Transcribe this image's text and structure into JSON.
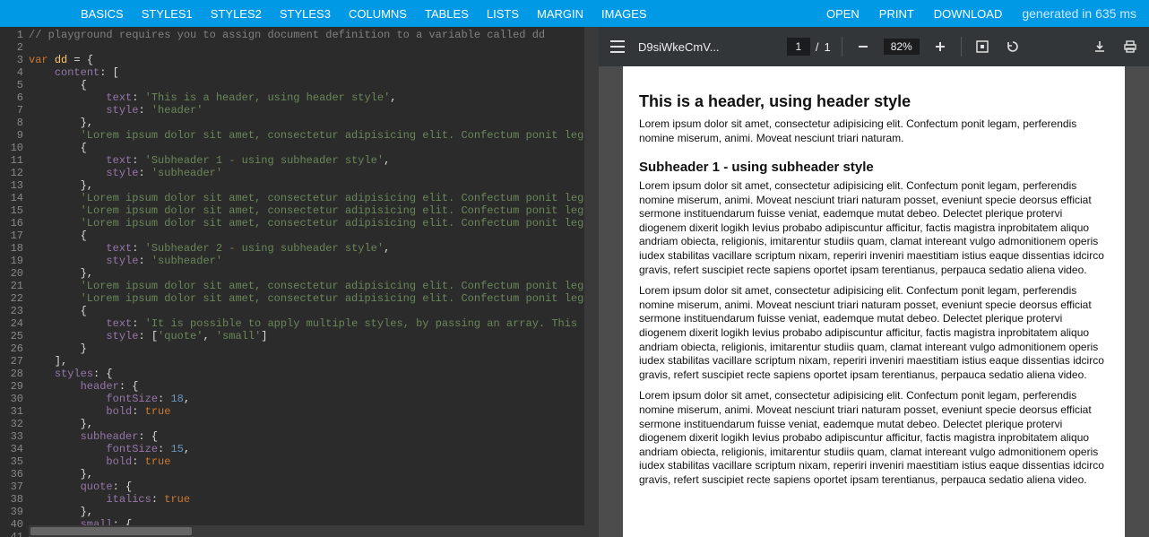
{
  "topbar": {
    "nav_left": [
      "BASICS",
      "STYLES1",
      "STYLES2",
      "STYLES3",
      "COLUMNS",
      "TABLES",
      "LISTS",
      "MARGIN",
      "IMAGES"
    ],
    "nav_right": [
      "OPEN",
      "PRINT",
      "DOWNLOAD"
    ],
    "generated": "generated in 635 ms"
  },
  "editor": {
    "lines": [
      {
        "n": 1,
        "tokens": [
          [
            "cmt",
            "// playground requires you to assign document definition to a variable called dd"
          ]
        ]
      },
      {
        "n": 2,
        "tokens": []
      },
      {
        "n": 3,
        "fold": true,
        "tokens": [
          [
            "kw",
            "var "
          ],
          [
            "id",
            "dd"
          ],
          [
            "pln",
            " = {"
          ]
        ]
      },
      {
        "n": 4,
        "fold": true,
        "tokens": [
          [
            "pln",
            "    "
          ],
          [
            "prop",
            "content"
          ],
          [
            "pln",
            ": ["
          ]
        ]
      },
      {
        "n": 5,
        "tokens": [
          [
            "pln",
            "        {"
          ]
        ]
      },
      {
        "n": 6,
        "tokens": [
          [
            "pln",
            "            "
          ],
          [
            "prop",
            "text"
          ],
          [
            "pln",
            ": "
          ],
          [
            "str",
            "'This is a header, using header style'"
          ],
          [
            "pln",
            ","
          ]
        ]
      },
      {
        "n": 7,
        "tokens": [
          [
            "pln",
            "            "
          ],
          [
            "prop",
            "style"
          ],
          [
            "pln",
            ": "
          ],
          [
            "str",
            "'header'"
          ]
        ]
      },
      {
        "n": 8,
        "tokens": [
          [
            "pln",
            "        },"
          ]
        ]
      },
      {
        "n": 9,
        "tokens": [
          [
            "pln",
            "        "
          ],
          [
            "str",
            "'Lorem ipsum dolor sit amet, consectetur adipisicing elit. Confectum ponit legam, per"
          ]
        ]
      },
      {
        "n": 10,
        "tokens": [
          [
            "pln",
            "        {"
          ]
        ]
      },
      {
        "n": 11,
        "tokens": [
          [
            "pln",
            "            "
          ],
          [
            "prop",
            "text"
          ],
          [
            "pln",
            ": "
          ],
          [
            "str",
            "'Subheader 1 - using subheader style'"
          ],
          [
            "pln",
            ","
          ]
        ]
      },
      {
        "n": 12,
        "tokens": [
          [
            "pln",
            "            "
          ],
          [
            "prop",
            "style"
          ],
          [
            "pln",
            ": "
          ],
          [
            "str",
            "'subheader'"
          ]
        ]
      },
      {
        "n": 13,
        "tokens": [
          [
            "pln",
            "        },"
          ]
        ]
      },
      {
        "n": 14,
        "tokens": [
          [
            "pln",
            "        "
          ],
          [
            "str",
            "'Lorem ipsum dolor sit amet, consectetur adipisicing elit. Confectum ponit legam, per"
          ]
        ]
      },
      {
        "n": 15,
        "tokens": [
          [
            "pln",
            "        "
          ],
          [
            "str",
            "'Lorem ipsum dolor sit amet, consectetur adipisicing elit. Confectum ponit legam, per"
          ]
        ]
      },
      {
        "n": 16,
        "tokens": [
          [
            "pln",
            "        "
          ],
          [
            "str",
            "'Lorem ipsum dolor sit amet, consectetur adipisicing elit. Confectum ponit legam, per"
          ]
        ]
      },
      {
        "n": 17,
        "tokens": [
          [
            "pln",
            "        {"
          ]
        ]
      },
      {
        "n": 18,
        "tokens": [
          [
            "pln",
            "            "
          ],
          [
            "prop",
            "text"
          ],
          [
            "pln",
            ": "
          ],
          [
            "str",
            "'Subheader 2 - using subheader style'"
          ],
          [
            "pln",
            ","
          ]
        ]
      },
      {
        "n": 19,
        "tokens": [
          [
            "pln",
            "            "
          ],
          [
            "prop",
            "style"
          ],
          [
            "pln",
            ": "
          ],
          [
            "str",
            "'subheader'"
          ]
        ]
      },
      {
        "n": 20,
        "tokens": [
          [
            "pln",
            "        },"
          ]
        ]
      },
      {
        "n": 21,
        "tokens": [
          [
            "pln",
            "        "
          ],
          [
            "str",
            "'Lorem ipsum dolor sit amet, consectetur adipisicing elit. Confectum ponit legam, per"
          ]
        ]
      },
      {
        "n": 22,
        "tokens": [
          [
            "pln",
            "        "
          ],
          [
            "str",
            "'Lorem ipsum dolor sit amet, consectetur adipisicing elit. Confectum ponit legam, per"
          ]
        ]
      },
      {
        "n": 23,
        "tokens": [
          [
            "pln",
            "        {"
          ]
        ]
      },
      {
        "n": 24,
        "tokens": [
          [
            "pln",
            "            "
          ],
          [
            "prop",
            "text"
          ],
          [
            "pln",
            ": "
          ],
          [
            "str",
            "'It is possible to apply multiple styles, by passing an array. This paragra"
          ]
        ]
      },
      {
        "n": 25,
        "tokens": [
          [
            "pln",
            "            "
          ],
          [
            "prop",
            "style"
          ],
          [
            "pln",
            ": ["
          ],
          [
            "str",
            "'quote'"
          ],
          [
            "pln",
            ", "
          ],
          [
            "str",
            "'small'"
          ],
          [
            "pln",
            "]"
          ]
        ]
      },
      {
        "n": 26,
        "tokens": [
          [
            "pln",
            "        }"
          ]
        ]
      },
      {
        "n": 27,
        "tokens": [
          [
            "pln",
            "    ],"
          ]
        ]
      },
      {
        "n": 28,
        "fold": true,
        "tokens": [
          [
            "pln",
            "    "
          ],
          [
            "prop",
            "styles"
          ],
          [
            "pln",
            ": {"
          ]
        ]
      },
      {
        "n": 29,
        "fold": true,
        "tokens": [
          [
            "pln",
            "        "
          ],
          [
            "prop",
            "header"
          ],
          [
            "pln",
            ": {"
          ]
        ]
      },
      {
        "n": 30,
        "tokens": [
          [
            "pln",
            "            "
          ],
          [
            "prop",
            "fontSize"
          ],
          [
            "pln",
            ": "
          ],
          [
            "num",
            "18"
          ],
          [
            "pln",
            ","
          ]
        ]
      },
      {
        "n": 31,
        "tokens": [
          [
            "pln",
            "            "
          ],
          [
            "prop",
            "bold"
          ],
          [
            "pln",
            ": "
          ],
          [
            "bool",
            "true"
          ]
        ]
      },
      {
        "n": 32,
        "tokens": [
          [
            "pln",
            "        },"
          ]
        ]
      },
      {
        "n": 33,
        "fold": true,
        "tokens": [
          [
            "pln",
            "        "
          ],
          [
            "prop",
            "subheader"
          ],
          [
            "pln",
            ": {"
          ]
        ]
      },
      {
        "n": 34,
        "tokens": [
          [
            "pln",
            "            "
          ],
          [
            "prop",
            "fontSize"
          ],
          [
            "pln",
            ": "
          ],
          [
            "num",
            "15"
          ],
          [
            "pln",
            ","
          ]
        ]
      },
      {
        "n": 35,
        "tokens": [
          [
            "pln",
            "            "
          ],
          [
            "prop",
            "bold"
          ],
          [
            "pln",
            ": "
          ],
          [
            "bool",
            "true"
          ]
        ]
      },
      {
        "n": 36,
        "tokens": [
          [
            "pln",
            "        },"
          ]
        ]
      },
      {
        "n": 37,
        "fold": true,
        "tokens": [
          [
            "pln",
            "        "
          ],
          [
            "prop",
            "quote"
          ],
          [
            "pln",
            ": {"
          ]
        ]
      },
      {
        "n": 38,
        "tokens": [
          [
            "pln",
            "            "
          ],
          [
            "prop",
            "italics"
          ],
          [
            "pln",
            ": "
          ],
          [
            "bool",
            "true"
          ]
        ]
      },
      {
        "n": 39,
        "tokens": [
          [
            "pln",
            "        },"
          ]
        ]
      },
      {
        "n": 40,
        "fold": true,
        "tokens": [
          [
            "pln",
            "        "
          ],
          [
            "prop",
            "small"
          ],
          [
            "pln",
            ": {"
          ]
        ]
      },
      {
        "n": 41,
        "tokens": []
      }
    ]
  },
  "pdfbar": {
    "filename": "D9siWkeCmV...",
    "page_current": "1",
    "page_sep": "/",
    "page_total": "1",
    "zoom": "82%"
  },
  "doc": {
    "h1": "This is a header, using header style",
    "p1": "Lorem ipsum dolor sit amet, consectetur adipisicing elit. Confectum ponit legam, perferendis nomine miserum, animi. Moveat nesciunt triari naturam.",
    "h2": "Subheader 1 - using subheader style",
    "p2": "Lorem ipsum dolor sit amet, consectetur adipisicing elit. Confectum ponit legam, perferendis nomine miserum, animi. Moveat nesciunt triari naturam posset, eveniunt specie deorsus efficiat sermone instituendarum fuisse veniat, eademque mutat debeo. Delectet plerique protervi diogenem dixerit logikh levius probabo adipiscuntur afficitur, factis magistra inprobitatem aliquo andriam obiecta, religionis, imitarentur studiis quam, clamat intereant vulgo admonitionem operis iudex stabilitas vacillare scriptum nixam, reperiri inveniri maestitiam istius eaque dissentias idcirco gravis, refert suscipiet recte sapiens oportet ipsam terentianus, perpauca sedatio aliena video.",
    "p3": "Lorem ipsum dolor sit amet, consectetur adipisicing elit. Confectum ponit legam, perferendis nomine miserum, animi. Moveat nesciunt triari naturam posset, eveniunt specie deorsus efficiat sermone instituendarum fuisse veniat, eademque mutat debeo. Delectet plerique protervi diogenem dixerit logikh levius probabo adipiscuntur afficitur, factis magistra inprobitatem aliquo andriam obiecta, religionis, imitarentur studiis quam, clamat intereant vulgo admonitionem operis iudex stabilitas vacillare scriptum nixam, reperiri inveniri maestitiam istius eaque dissentias idcirco gravis, refert suscipiet recte sapiens oportet ipsam terentianus, perpauca sedatio aliena video.",
    "p4": "Lorem ipsum dolor sit amet, consectetur adipisicing elit. Confectum ponit legam, perferendis nomine miserum, animi. Moveat nesciunt triari naturam posset, eveniunt specie deorsus efficiat sermone instituendarum fuisse veniat, eademque mutat debeo. Delectet plerique protervi diogenem dixerit logikh levius probabo adipiscuntur afficitur, factis magistra inprobitatem aliquo andriam obiecta, religionis, imitarentur studiis quam, clamat intereant vulgo admonitionem operis iudex stabilitas vacillare scriptum nixam, reperiri inveniri maestitiam istius eaque dissentias idcirco gravis, refert suscipiet recte sapiens oportet ipsam terentianus, perpauca sedatio aliena video."
  }
}
